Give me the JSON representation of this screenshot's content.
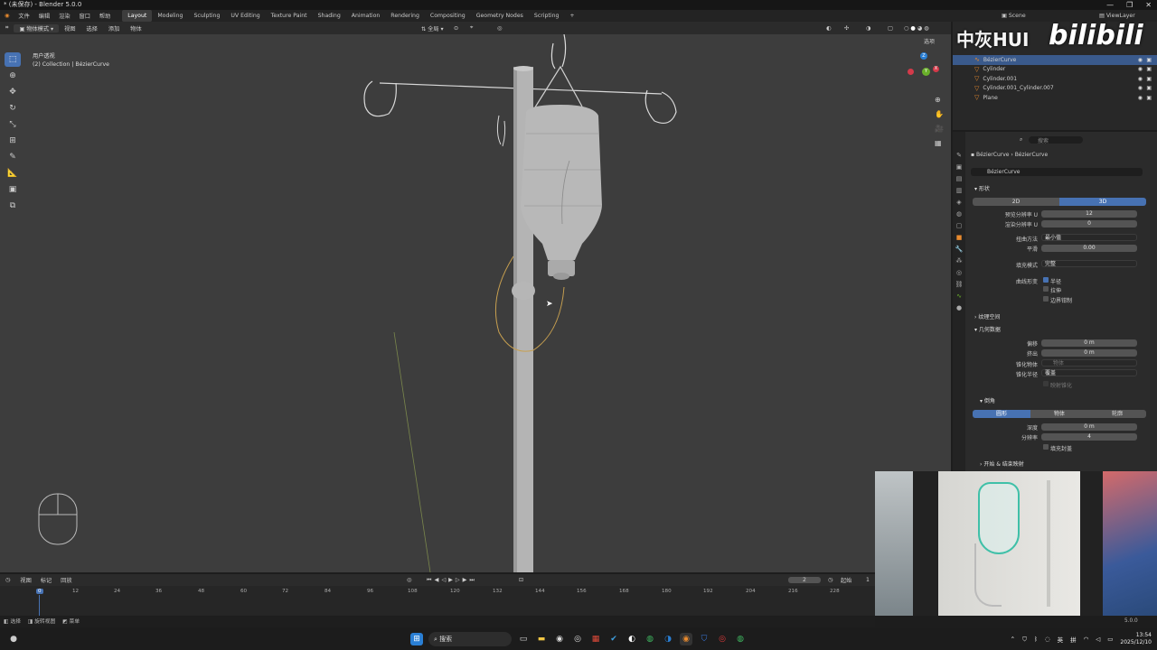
{
  "window": {
    "title": "* (未保存) - Blender 5.0.0",
    "controls": [
      "—",
      "❐",
      "✕"
    ]
  },
  "menu": [
    "文件",
    "编辑",
    "渲染",
    "窗口",
    "帮助"
  ],
  "workspaces": [
    "Layout",
    "Modeling",
    "Sculpting",
    "UV Editing",
    "Texture Paint",
    "Shading",
    "Animation",
    "Rendering",
    "Compositing",
    "Geometry Nodes",
    "Scripting"
  ],
  "workspace_add": "+",
  "scene": {
    "label": "Scene",
    "view_layer": "ViewLayer"
  },
  "viewport": {
    "mode": "物体模式",
    "menus": [
      "视图",
      "选择",
      "添加",
      "物体"
    ],
    "transform": "全局",
    "view_name": "用户透视",
    "collection_info": "(2) Collection | BézierCurve",
    "options": "选项"
  },
  "gizmo": {
    "z": "Z",
    "y": "Y",
    "x": "X"
  },
  "outliner": {
    "items": [
      {
        "name": "BézierCurve",
        "selected": true
      },
      {
        "name": "Cylinder",
        "selected": false
      },
      {
        "name": "Cylinder.001",
        "selected": false
      },
      {
        "name": "Cylinder.001_Cylinder.007",
        "selected": false
      },
      {
        "name": "Plane",
        "selected": false
      }
    ]
  },
  "properties": {
    "search_placeholder": "搜索",
    "breadcrumb_object": "BézierCurve",
    "breadcrumb_data": "BézierCurve",
    "datablock": "BézierCurve",
    "shape_section": "形状",
    "dim_2d": "2D",
    "dim_3d": "3D",
    "preview_res_label": "预览分辨率 U",
    "preview_res_value": "12",
    "render_res_label": "渲染分辨率 U",
    "render_res_value": "0",
    "twist_method_label": "扭曲方法",
    "twist_method_value": "最小值",
    "smooth_label": "平滑",
    "smooth_value": "0.00",
    "fill_mode_label": "填充模式",
    "fill_mode_value": "完整",
    "curve_deform_label": "曲线形变",
    "radius_label": "半径",
    "stretch_label": "拉伸",
    "bounds_clamp_label": "边界钳制",
    "texture_space_section": "纹理空间",
    "geometry_section": "几何数据",
    "offset_label": "偏移",
    "offset_value": "0 m",
    "extrude_label": "挤出",
    "extrude_value": "0 m",
    "taper_obj_label": "锥化物体",
    "taper_obj_placeholder": "物体",
    "taper_radius_label": "锥化半径",
    "taper_radius_value": "覆盖",
    "map_taper_label": "映射锥化",
    "bevel_section": "倒角",
    "bevel_round": "圆形",
    "bevel_object": "物体",
    "bevel_profile": "轮廓",
    "depth_label": "深度",
    "depth_value": "0 m",
    "resolution_label": "分辨率",
    "resolution_value": "4",
    "fill_caps_label": "填充封盖",
    "start_end_section": "开始 & 结束映射"
  },
  "timeline": {
    "menus": [
      "视图",
      "标记",
      "回放"
    ],
    "current_frame": "2",
    "start_label": "起始",
    "start_value": "1",
    "ticks": [
      "0",
      "12",
      "24",
      "36",
      "48",
      "60",
      "72",
      "84",
      "96",
      "108",
      "120",
      "132",
      "144",
      "156",
      "168",
      "180",
      "192",
      "204",
      "216",
      "228"
    ]
  },
  "statusbar": {
    "items": [
      "选择",
      "旋转视图",
      "菜单"
    ],
    "version": "5.0.0"
  },
  "taskbar": {
    "search": "搜索",
    "lang": "英",
    "ime": "拼",
    "time": "13:54",
    "date": "2025/12/10"
  },
  "watermark": {
    "text1": "中灰HUI",
    "text2": "bilibili"
  },
  "colors": {
    "accent": "#4772b3",
    "selected_row": "#3a5a8c",
    "object_orange": "#e88a2e",
    "curve": "#c8a050"
  }
}
